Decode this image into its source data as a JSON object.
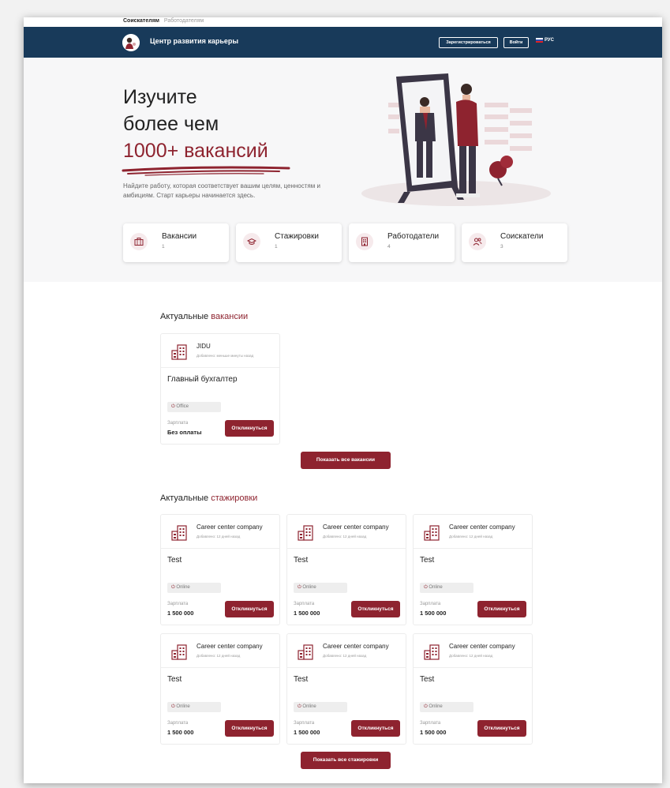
{
  "top_tabs": {
    "active": "Соискателям",
    "inactive": "Работодателям"
  },
  "navbar": {
    "brand": "Центр развития карьеры",
    "register_label": "Зарегистрироваться",
    "login_label": "Войти",
    "language": "РУС"
  },
  "hero": {
    "line1": "Изучите",
    "line2": "более чем",
    "line3": "1000+ вакансий",
    "subtitle": "Найдите работу, которая соответствует вашим целям, ценностям и амбициям. Старт карьеры начинается здесь."
  },
  "stats": [
    {
      "title": "Вакансии",
      "count": "1",
      "icon": "briefcase-icon"
    },
    {
      "title": "Стажировки",
      "count": "1",
      "icon": "graduation-cap-icon"
    },
    {
      "title": "Работодатели",
      "count": "4",
      "icon": "building-icon"
    },
    {
      "title": "Соискатели",
      "count": "3",
      "icon": "users-icon"
    }
  ],
  "vacancies": {
    "title_plain": "Актуальные",
    "title_accent": "вакансии",
    "items": [
      {
        "company": "JIDU",
        "added": "Добавлено: меньше минуты назад",
        "title": "Главный бухгалтер",
        "format": "Office",
        "salary_label": "Зарплата",
        "salary": "Без оплаты",
        "apply_label": "Откликнуться"
      }
    ],
    "show_all_label": "Показать все вакансии"
  },
  "internships": {
    "title_plain": "Актуальные",
    "title_accent": "стажировки",
    "items": [
      {
        "company": "Career center company",
        "added": "Добавлено: 12 дней назад",
        "title": "Test",
        "format": "Online",
        "salary_label": "Зарплата",
        "salary": "1 500 000",
        "apply_label": "Откликнуться"
      },
      {
        "company": "Career center company",
        "added": "Добавлено: 12 дней назад",
        "title": "Test",
        "format": "Online",
        "salary_label": "Зарплата",
        "salary": "1 500 000",
        "apply_label": "Откликнуться"
      },
      {
        "company": "Career center company",
        "added": "Добавлено: 12 дней назад",
        "title": "Test",
        "format": "Online",
        "salary_label": "Зарплата",
        "salary": "1 500 000",
        "apply_label": "Откликнуться"
      },
      {
        "company": "Career center company",
        "added": "Добавлено: 12 дней назад",
        "title": "Test",
        "format": "Online",
        "salary_label": "Зарплата",
        "salary": "1 500 000",
        "apply_label": "Откликнуться"
      },
      {
        "company": "Career center company",
        "added": "Добавлено: 12 дней назад",
        "title": "Test",
        "format": "Online",
        "salary_label": "Зарплата",
        "salary": "1 500 000",
        "apply_label": "Откликнуться"
      },
      {
        "company": "Career center company",
        "added": "Добавлено: 12 дней назад",
        "title": "Test",
        "format": "Online",
        "salary_label": "Зарплата",
        "salary": "1 500 000",
        "apply_label": "Откликнуться"
      }
    ],
    "show_all_label": "Показать все стажировки"
  },
  "colors": {
    "navbar": "#183a5a",
    "accent": "#8e232f",
    "hero_bg": "#f7f7f8"
  }
}
